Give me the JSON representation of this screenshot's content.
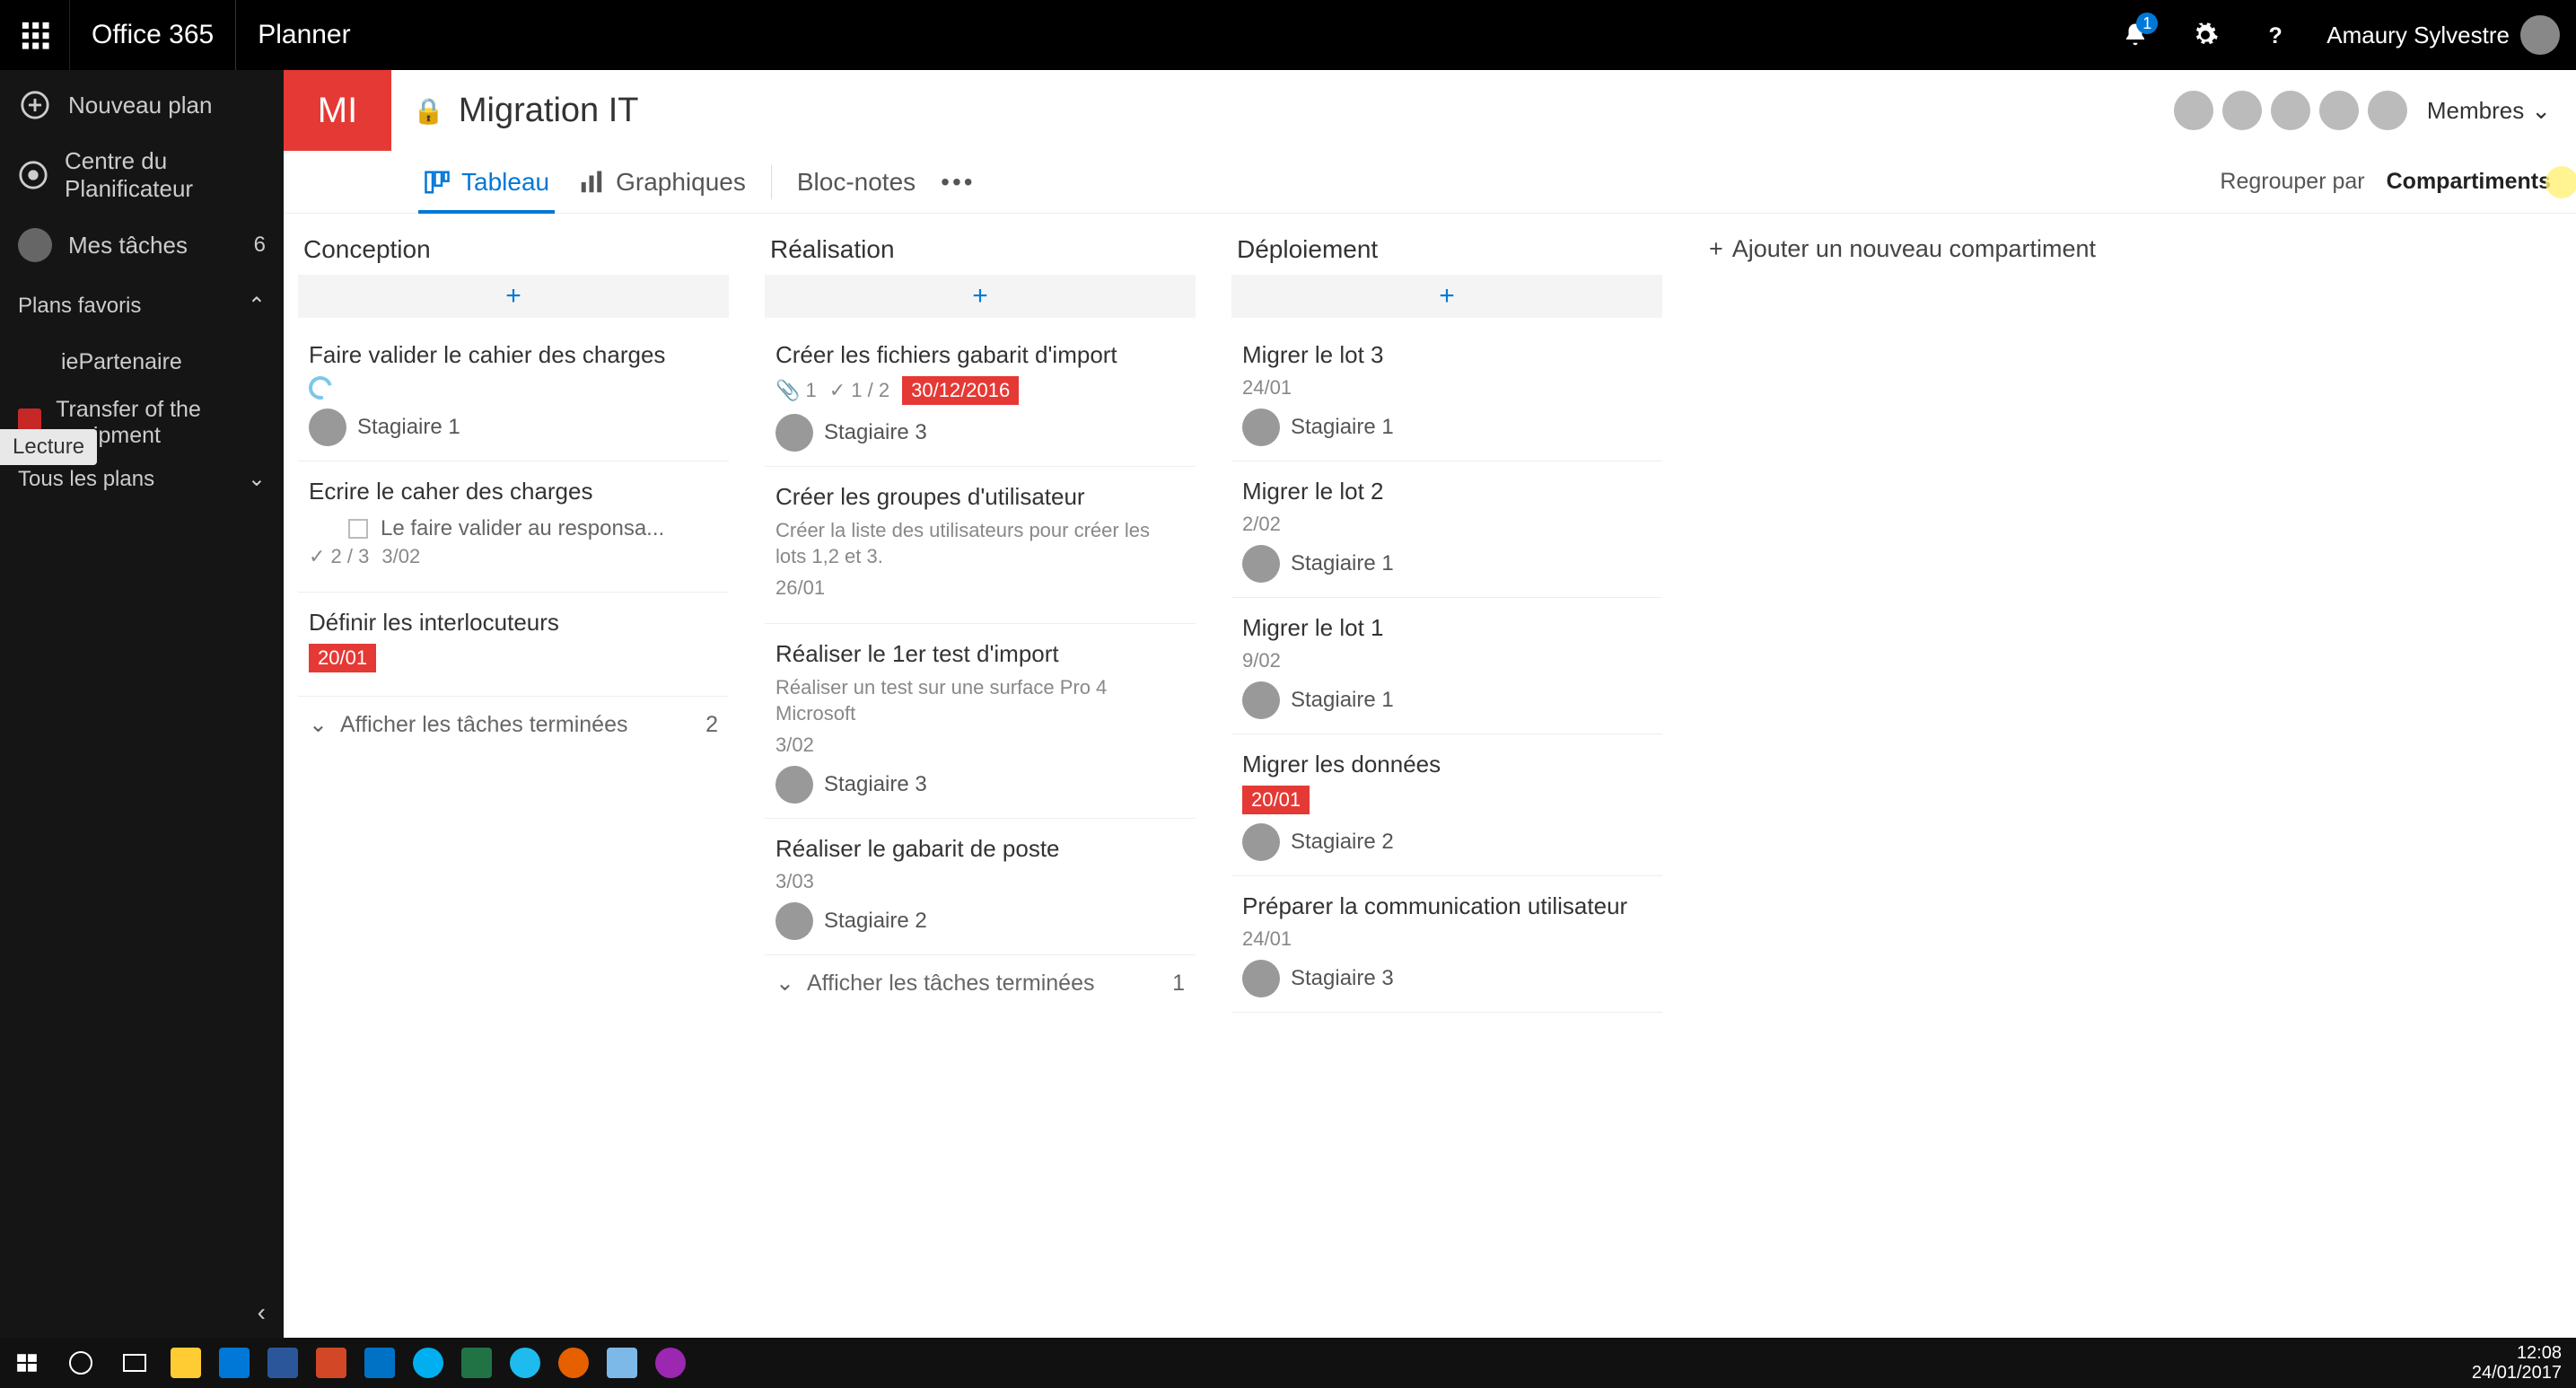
{
  "suite": {
    "brand": "Office 365",
    "app": "Planner",
    "notification_count": "1",
    "user_name": "Amaury Sylvestre"
  },
  "leftnav": {
    "new_plan": "Nouveau plan",
    "hub": "Centre du Planificateur",
    "my_tasks": "Mes tâches",
    "my_tasks_count": "6",
    "fav_header": "Plans favoris",
    "lecture_tag": "Lecture",
    "fav1": "iePartenaire",
    "fav2": "Transfer of the equipment",
    "all_plans": "Tous les plans"
  },
  "plan": {
    "initials": "MI",
    "title": "Migration IT",
    "members_label": "Membres",
    "group_by_label": "Regrouper par",
    "group_by_value": "Compartiments"
  },
  "tabs": {
    "board": "Tableau",
    "charts": "Graphiques",
    "notebook": "Bloc-notes"
  },
  "board": {
    "add_bucket": "Ajouter un nouveau compartiment",
    "show_done": "Afficher les tâches terminées",
    "buckets": [
      {
        "name": "Conception",
        "done_count": "2",
        "cards": [
          {
            "title": "Faire valider le cahier des charges",
            "progress_ring": true,
            "assignee": "Stagiaire 1"
          },
          {
            "title": "Ecrire le caher des charges",
            "subtask": "Le faire valider au responsa...",
            "checklist": "2 / 3",
            "date": "3/02"
          },
          {
            "title": "Définir les interlocuteurs",
            "pill": "20/01"
          }
        ]
      },
      {
        "name": "Réalisation",
        "done_count": "1",
        "cards": [
          {
            "title": "Créer les fichiers gabarit d'import",
            "attach": "1",
            "checklist": "1 / 2",
            "pill": "30/12/2016",
            "assignee": "Stagiaire 3"
          },
          {
            "title": "Créer les groupes d'utilisateur",
            "desc": "Créer la liste des utilisateurs pour créer les lots 1,2 et 3.",
            "date": "26/01"
          },
          {
            "title": "Réaliser le 1er test d'import",
            "desc": "Réaliser un test sur une surface Pro 4 Microsoft",
            "date": "3/02",
            "assignee": "Stagiaire 3"
          },
          {
            "title": "Réaliser le gabarit de poste",
            "date": "3/03",
            "assignee": "Stagiaire 2"
          }
        ]
      },
      {
        "name": "Déploiement",
        "cards": [
          {
            "title": "Migrer le lot 3",
            "date": "24/01",
            "assignee": "Stagiaire 1"
          },
          {
            "title": "Migrer le lot 2",
            "date": "2/02",
            "assignee": "Stagiaire 1"
          },
          {
            "title": "Migrer le lot 1",
            "date": "9/02",
            "assignee": "Stagiaire 1"
          },
          {
            "title": "Migrer les données",
            "pill": "20/01",
            "assignee": "Stagiaire 2"
          },
          {
            "title": "Préparer la communication utilisateur",
            "date": "24/01",
            "assignee": "Stagiaire 3"
          }
        ]
      }
    ]
  },
  "taskbar": {
    "time": "12:08",
    "date": "24/01/2017",
    "apps": [
      "windows",
      "cortana",
      "taskview",
      "explorer",
      "edge",
      "word",
      "powerpoint",
      "outlook",
      "skype",
      "excel",
      "ie",
      "firefox",
      "notepad",
      "other"
    ]
  }
}
